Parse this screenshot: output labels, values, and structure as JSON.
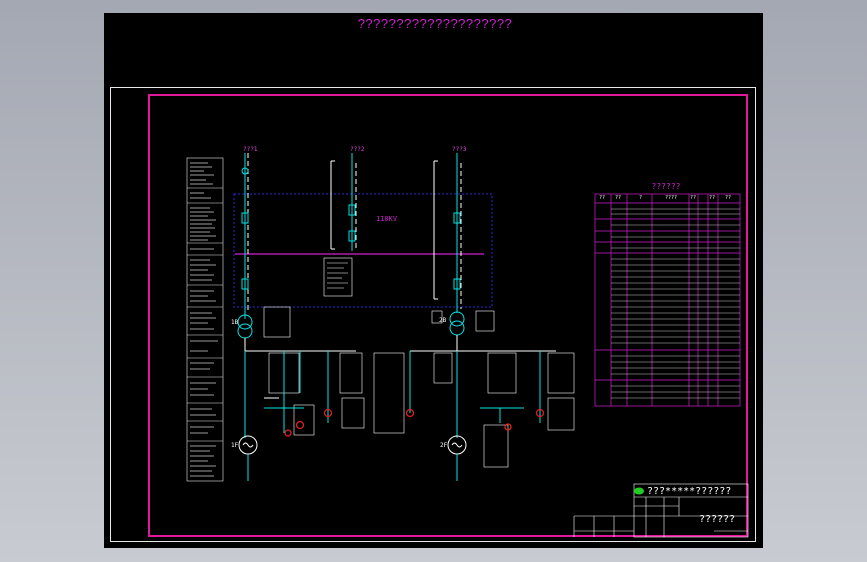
{
  "page": {
    "title": "????????????????????"
  },
  "diagram": {
    "feeders": [
      "???1",
      "???2",
      "???3"
    ],
    "bus_label": "110KV",
    "transformers": [
      "1B",
      "2B"
    ],
    "generators": [
      "1F",
      "2F"
    ]
  },
  "equipment_table": {
    "title": "??????",
    "columns": [
      "??",
      "??",
      "?",
      "????",
      "??",
      "??",
      "??"
    ]
  },
  "title_block": {
    "project": "???*****??????",
    "drawing_name": "??????"
  },
  "colors": {
    "background": "#000000",
    "frame": "#e0189a",
    "line_cyan": "#00e5e5",
    "line_white": "#ffffff",
    "highlight": "#d020d0",
    "breaker_red": "#e02020",
    "bus_blue": "#2a2ad8",
    "logo_green": "#22cc22"
  }
}
